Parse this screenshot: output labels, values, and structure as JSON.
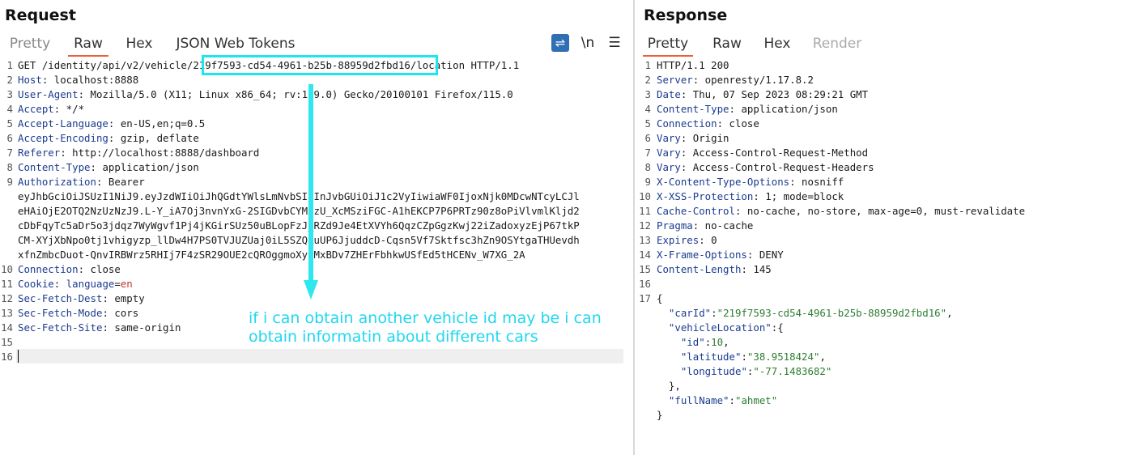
{
  "request": {
    "title": "Request",
    "tabs": [
      "Pretty",
      "Raw",
      "Hex",
      "JSON Web Tokens"
    ],
    "active_tab": "Raw",
    "tools": {
      "wrap": "⇌",
      "newline": "\\n",
      "menu": "☰"
    },
    "lines": [
      {
        "n": "1",
        "text": "GET /identity/api/v2/vehicle/219f7593-cd54-4961-b25b-88959d2fbd16/location HTTP/1.1"
      },
      {
        "n": "2",
        "key": "Host",
        "value": ": localhost:8888"
      },
      {
        "n": "3",
        "key": "User-Agent",
        "value": ": Mozilla/5.0 (X11; Linux x86_64; rv:109.0) Gecko/20100101 Firefox/115.0"
      },
      {
        "n": "4",
        "key": "Accept",
        "value": ": */*"
      },
      {
        "n": "5",
        "key": "Accept-Language",
        "value": ": en-US,en;q=0.5"
      },
      {
        "n": "6",
        "key": "Accept-Encoding",
        "value": ": gzip, deflate"
      },
      {
        "n": "7",
        "key": "Referer",
        "value": ": http://localhost:8888/dashboard"
      },
      {
        "n": "8",
        "key": "Content-Type",
        "value": ": application/json"
      },
      {
        "n": "9",
        "key": "Authorization",
        "value": ": Bearer"
      },
      {
        "n": "",
        "text": "eyJhbGciOiJSUzI1NiJ9.eyJzdWIiOiJhQGdtYWlsLmNvbSIsInJvbGUiOiJ1c2VyIiwiaWF0IjoxNjk0MDcwNTcyLCJl"
      },
      {
        "n": "",
        "text": "eHAiOjE2OTQ2NzUzNzJ9.L-Y_iA7Oj3nvnYxG-2SIGDvbCYMizU_XcMSziFGC-A1hEKCP7P6PRTz90z8oPiVlvmlKljd2"
      },
      {
        "n": "",
        "text": "cDbFqyTc5aDr5o3jdqz7WyWgvf1Pj4jKGirSUz50uBLopFzJ_RZd9Je4EtXVYh6QqzCZpGgzKwj22iZadoxyzEjP67tkP"
      },
      {
        "n": "",
        "text": "CM-XYjXbNpo0tj1vhigyzp_llDw4H7PS0TVJUZUaj0iL5SZQRuUP6JjuddcD-Cqsn5Vf7Sktfsc3hZn9OSYtgaTHUevdh"
      },
      {
        "n": "",
        "text": "xfnZmbcDuot-QnvIRBWrz5RHIj7F4zSR29OUE2cQROggmoXyqMxBDv7ZHErFbhkwUSfEd5tHCENv_W7XG_2A"
      },
      {
        "n": "10",
        "key": "Connection",
        "value": ": close"
      },
      {
        "n": "11",
        "key": "Cookie",
        "value": ": ",
        "cookie_key": "language",
        "cookie_eq": "=",
        "cookie_val": "en"
      },
      {
        "n": "12",
        "key": "Sec-Fetch-Dest",
        "value": ": empty"
      },
      {
        "n": "13",
        "key": "Sec-Fetch-Mode",
        "value": ": cors"
      },
      {
        "n": "14",
        "key": "Sec-Fetch-Site",
        "value": ": same-origin"
      },
      {
        "n": "15",
        "text": ""
      },
      {
        "n": "16",
        "text": ""
      }
    ]
  },
  "annotation": {
    "text": "if i can obtain another vehicle id may be i can obtain informatin about different cars"
  },
  "response": {
    "title": "Response",
    "tabs": [
      "Pretty",
      "Raw",
      "Hex",
      "Render"
    ],
    "active_tab": "Pretty",
    "lines": [
      {
        "n": "1",
        "text": "HTTP/1.1 200"
      },
      {
        "n": "2",
        "key": "Server",
        "value": ": openresty/1.17.8.2"
      },
      {
        "n": "3",
        "key": "Date",
        "value": ": Thu, 07 Sep 2023 08:29:21 GMT"
      },
      {
        "n": "4",
        "key": "Content-Type",
        "value": ": application/json"
      },
      {
        "n": "5",
        "key": "Connection",
        "value": ": close"
      },
      {
        "n": "6",
        "key": "Vary",
        "value": ": Origin"
      },
      {
        "n": "7",
        "key": "Vary",
        "value": ": Access-Control-Request-Method"
      },
      {
        "n": "8",
        "key": "Vary",
        "value": ": Access-Control-Request-Headers"
      },
      {
        "n": "9",
        "key": "X-Content-Type-Options",
        "value": ": nosniff"
      },
      {
        "n": "10",
        "key": "X-XSS-Protection",
        "value": ": 1; mode=block"
      },
      {
        "n": "11",
        "key": "Cache-Control",
        "value": ": no-cache, no-store, max-age=0, must-revalidate"
      },
      {
        "n": "12",
        "key": "Pragma",
        "value": ": no-cache"
      },
      {
        "n": "13",
        "key": "Expires",
        "value": ": 0"
      },
      {
        "n": "14",
        "key": "X-Frame-Options",
        "value": ": DENY"
      },
      {
        "n": "15",
        "key": "Content-Length",
        "value": ": 145"
      },
      {
        "n": "16",
        "text": ""
      },
      {
        "n": "17",
        "text": "{"
      },
      {
        "n": "",
        "indent": "  ",
        "jkey": "\"carId\"",
        "sep": ":",
        "jval": "\"219f7593-cd54-4961-b25b-88959d2fbd16\"",
        "tail": ","
      },
      {
        "n": "",
        "indent": "  ",
        "jkey": "\"vehicleLocation\"",
        "sep": ":",
        "jval": "",
        "tail": "{"
      },
      {
        "n": "",
        "indent": "    ",
        "jkey": "\"id\"",
        "sep": ":",
        "jval": "10",
        "tail": ","
      },
      {
        "n": "",
        "indent": "    ",
        "jkey": "\"latitude\"",
        "sep": ":",
        "jval": "\"38.9518424\"",
        "tail": ","
      },
      {
        "n": "",
        "indent": "    ",
        "jkey": "\"longitude\"",
        "sep": ":",
        "jval": "\"-77.1483682\"",
        "tail": ""
      },
      {
        "n": "",
        "text": "  },"
      },
      {
        "n": "",
        "indent": "  ",
        "jkey": "\"fullName\"",
        "sep": ":",
        "jval": "\"ahmet\"",
        "tail": ""
      },
      {
        "n": "",
        "text": "}"
      }
    ]
  },
  "colors": {
    "accent": "#e8613c",
    "annotation": "#20d7f0",
    "header_key": "#1b3b8f",
    "json_string": "#2e7d32"
  }
}
